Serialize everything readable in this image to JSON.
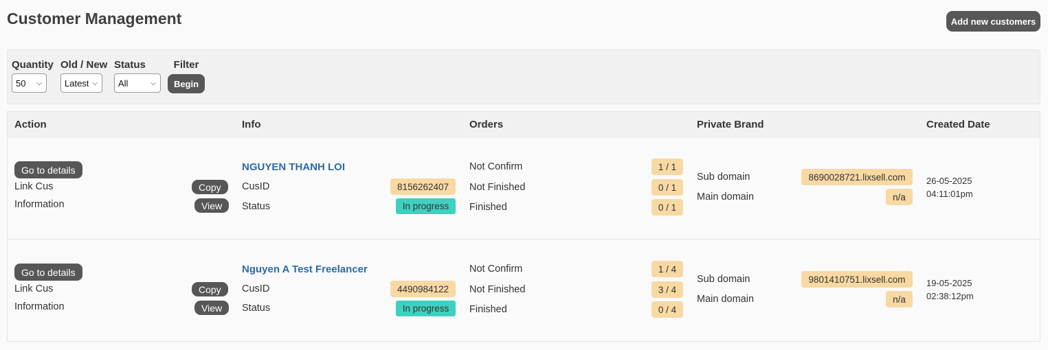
{
  "page": {
    "title": "Customer Management",
    "add_button": "Add new customers"
  },
  "filters": {
    "quantity": {
      "label": "Quantity",
      "value": "50"
    },
    "order": {
      "label": "Old / New",
      "value": "Latest"
    },
    "status": {
      "label": "Status",
      "value": "All"
    },
    "filter": {
      "label": "Filter",
      "button": "Begin"
    }
  },
  "table": {
    "headers": [
      "Action",
      "Info",
      "Orders",
      "Private Brand",
      "Created Date"
    ],
    "rows": [
      {
        "action": {
          "goto": "Go to details",
          "link_label": "Link Cus",
          "copy": "Copy",
          "info_label": "Information",
          "view": "View"
        },
        "info": {
          "name": "NGUYEN THANH LOI",
          "cusid_label": "CusID",
          "cusid": "8156262407",
          "status_label": "Status",
          "status": "In progress"
        },
        "orders": [
          {
            "label": "Not Confirm",
            "value": "1 / 1"
          },
          {
            "label": "Not Finished",
            "value": "0 / 1"
          },
          {
            "label": "Finished",
            "value": "0 / 1"
          }
        ],
        "brand": {
          "sub_label": "Sub domain",
          "sub": "8690028721.lixsell.com",
          "main_label": "Main domain",
          "main": "n/a"
        },
        "created": {
          "date": "26-05-2025",
          "time": "04:11:01pm"
        }
      },
      {
        "action": {
          "goto": "Go to details",
          "link_label": "Link Cus",
          "copy": "Copy",
          "info_label": "Information",
          "view": "View"
        },
        "info": {
          "name": "Nguyen A Test Freelancer",
          "cusid_label": "CusID",
          "cusid": "4490984122",
          "status_label": "Status",
          "status": "In progress"
        },
        "orders": [
          {
            "label": "Not Confirm",
            "value": "1 / 4"
          },
          {
            "label": "Not Finished",
            "value": "3 / 4"
          },
          {
            "label": "Finished",
            "value": "0 / 4"
          }
        ],
        "brand": {
          "sub_label": "Sub domain",
          "sub": "9801410751.lixsell.com",
          "main_label": "Main domain",
          "main": "n/a"
        },
        "created": {
          "date": "19-05-2025",
          "time": "02:38:12pm"
        }
      }
    ]
  },
  "colors": {
    "accent_button": "#575757",
    "link_name": "#2c6aa6",
    "badge": "#f8d9a3",
    "status_badge": "#3ed1c0"
  },
  "icons": {
    "select_arrow": "chevron-down-icon"
  }
}
